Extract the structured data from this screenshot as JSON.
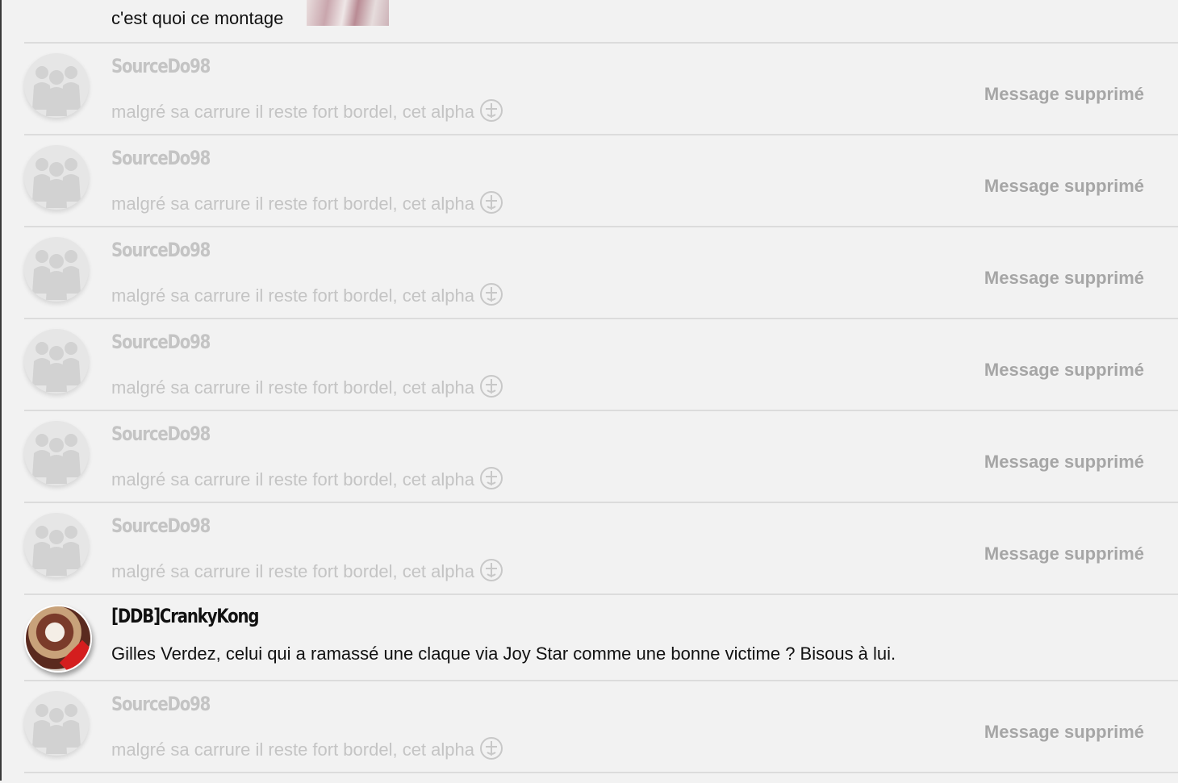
{
  "top_message": {
    "text": "c'est quoi ce montage"
  },
  "posts": [
    {
      "author": "SourceDo98",
      "text": "malgré sa carrure il reste fort bordel, cet alpha",
      "status": "Message supprimé"
    },
    {
      "author": "SourceDo98",
      "text": "malgré sa carrure il reste fort bordel, cet alpha",
      "status": "Message supprimé"
    },
    {
      "author": "SourceDo98",
      "text": "malgré sa carrure il reste fort bordel, cet alpha",
      "status": "Message supprimé"
    },
    {
      "author": "SourceDo98",
      "text": "malgré sa carrure il reste fort bordel, cet alpha",
      "status": "Message supprimé"
    },
    {
      "author": "SourceDo98",
      "text": "malgré sa carrure il reste fort bordel, cet alpha",
      "status": "Message supprimé"
    },
    {
      "author": "SourceDo98",
      "text": "malgré sa carrure il reste fort bordel, cet alpha",
      "status": "Message supprimé"
    },
    {
      "author": "[DDB]CrankyKong",
      "text": "Gilles Verdez, celui qui a ramassé une claque via Joy Star comme une bonne victime ? Bisous à lui."
    },
    {
      "author": "SourceDo98",
      "text": "malgré sa carrure il reste fort bordel, cet alpha",
      "status": "Message supprimé"
    }
  ],
  "icons": {
    "deleted_avatar": "silhouette-avatar-icon",
    "smiley": "smiley-icon"
  }
}
